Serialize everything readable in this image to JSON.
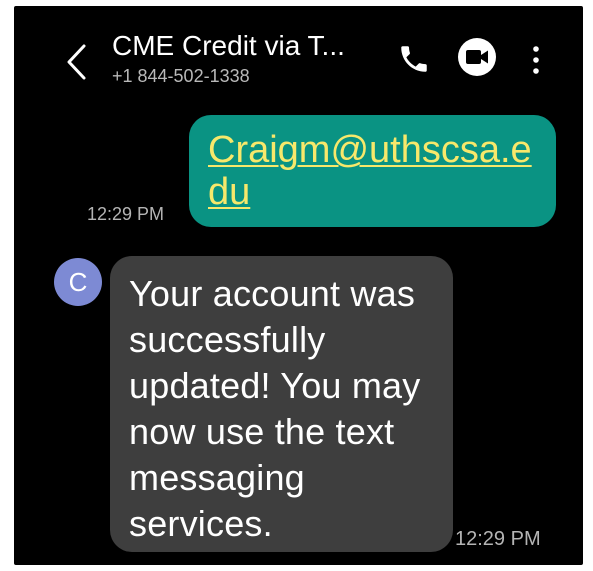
{
  "header": {
    "title": "CME Credit via T...",
    "subtitle": "+1 844-502-1338",
    "icons": [
      "back-arrow-icon",
      "phone-icon",
      "video-call-icon",
      "more-options-icon"
    ]
  },
  "messages": {
    "sent": {
      "text": "Craigm@uthscsa.edu",
      "time": "12:29 PM"
    },
    "received": {
      "avatar_letter": "C",
      "text": "Your account was successfully updated!  You may now use the text messaging services.",
      "time": "12:29 PM"
    }
  },
  "colors": {
    "background": "#000000",
    "sent_bubble": "#0a9383",
    "link_text": "#f7e86b",
    "received_bubble": "#3e3e3e",
    "avatar": "#7d8ad4"
  }
}
